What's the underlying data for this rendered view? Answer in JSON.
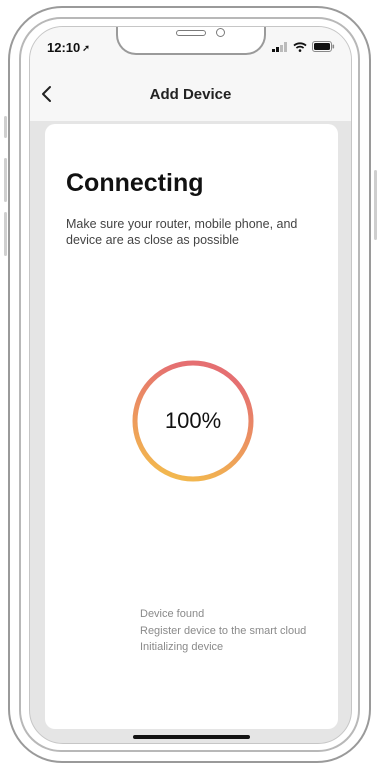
{
  "status_bar": {
    "time": "12:10"
  },
  "nav": {
    "title": "Add Device"
  },
  "content": {
    "heading": "Connecting",
    "subtitle": "Make sure your router, mobile phone, and device are as close as possible",
    "progress": {
      "percent": 100,
      "label": "100%"
    },
    "steps": [
      "Device found",
      "Register device to the smart cloud",
      "Initializing device"
    ]
  },
  "icons": {
    "back": "chevron-left-icon",
    "location": "location-arrow-icon",
    "signal": "cellular-signal-icon",
    "wifi": "wifi-icon",
    "battery": "battery-icon"
  },
  "colors": {
    "ring_start": "#f4c04a",
    "ring_end": "#e56f71",
    "background": "#e5e5e5",
    "card": "#ffffff"
  }
}
